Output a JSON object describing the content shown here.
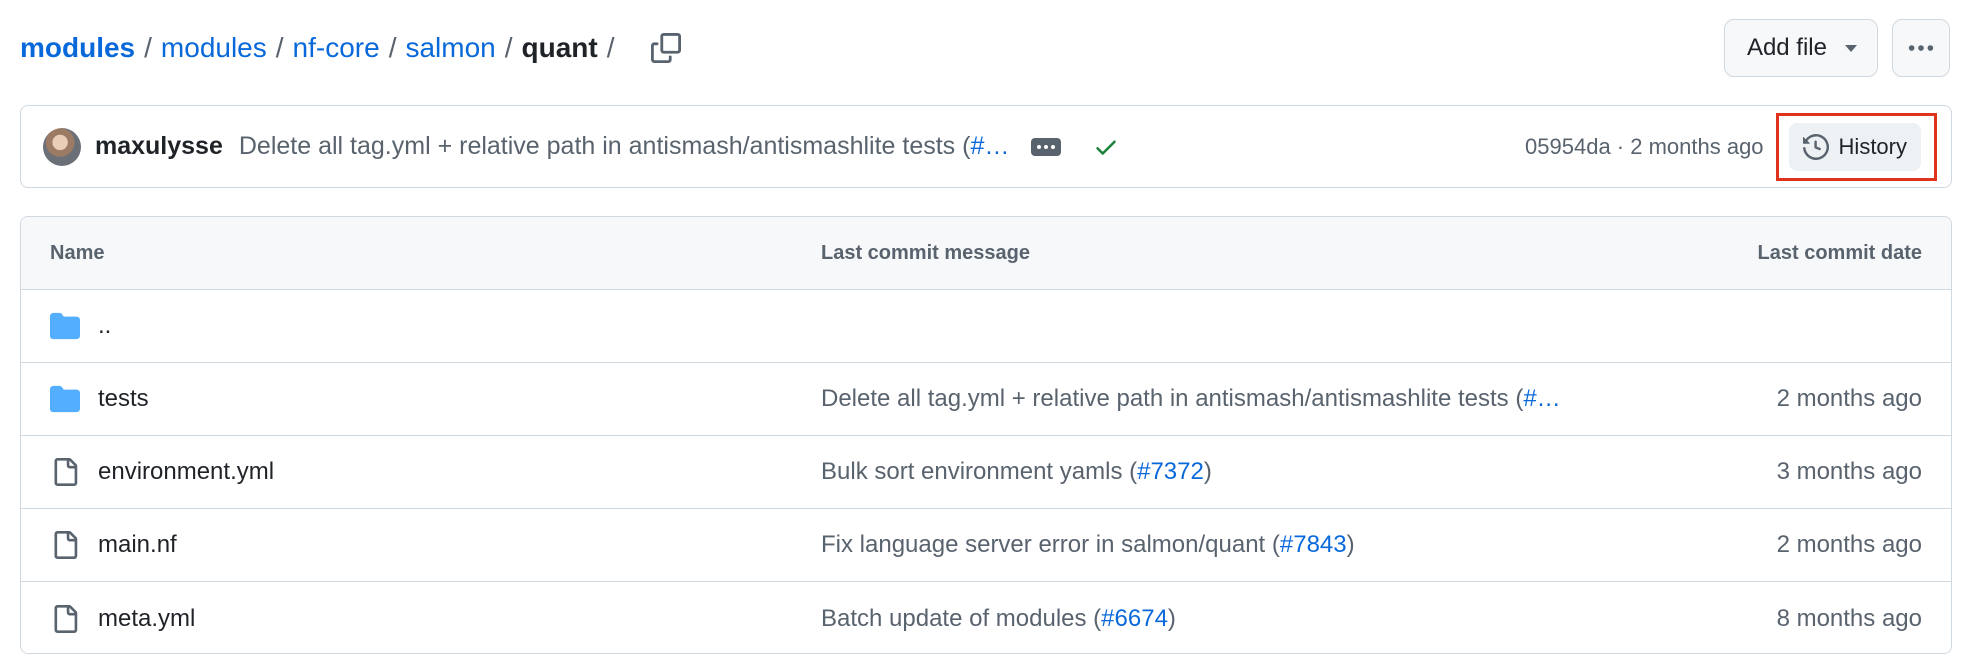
{
  "breadcrumb": {
    "root": "modules",
    "items": [
      "modules",
      "nf-core",
      "salmon"
    ],
    "current": "quant",
    "separator": "/"
  },
  "actions": {
    "add_file_label": "Add file"
  },
  "latest_commit": {
    "author": "maxulysse",
    "message": "Delete all tag.yml + relative path in antismash/antismashlite tests (",
    "pr_truncated": "#…",
    "meta": "05954da · 2 months ago",
    "history_label": "History",
    "status": "success"
  },
  "table": {
    "headers": {
      "name": "Name",
      "message": "Last commit message",
      "date": "Last commit date"
    },
    "parent": "..",
    "rows": [
      {
        "type": "folder",
        "name": "tests",
        "msg_pre": "Delete all tag.yml + relative path in antismash/antismashlite tests (",
        "msg_pr": "#…",
        "msg_post": "",
        "date": "2 months ago"
      },
      {
        "type": "file",
        "name": "environment.yml",
        "msg_pre": "Bulk sort environment yamls (",
        "msg_pr": "#7372",
        "msg_post": ")",
        "date": "3 months ago"
      },
      {
        "type": "file",
        "name": "main.nf",
        "msg_pre": "Fix language server error in salmon/quant (",
        "msg_pr": "#7843",
        "msg_post": ")",
        "date": "2 months ago"
      },
      {
        "type": "file",
        "name": "meta.yml",
        "msg_pre": "Batch update of modules (",
        "msg_pr": "#6674",
        "msg_post": ")",
        "date": "8 months ago"
      }
    ]
  },
  "colors": {
    "link": "#0969da",
    "folder": "#54aeff",
    "success": "#1a7f37",
    "highlight": "#e0331d"
  }
}
